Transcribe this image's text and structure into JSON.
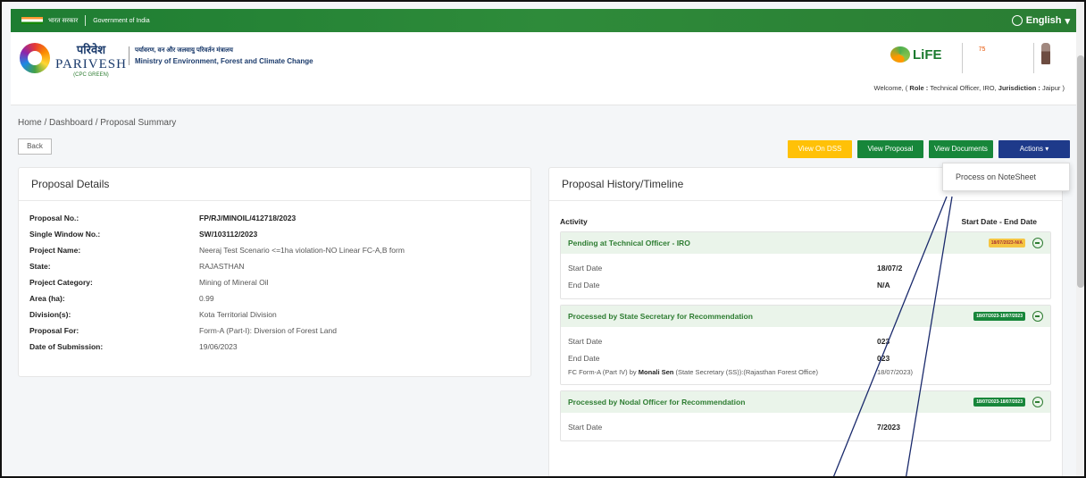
{
  "gov_bar": {
    "hindi_label": "भारत सरकार",
    "label": "Government of India",
    "language": "English"
  },
  "brand": {
    "hindi": "परिवेश",
    "name": "PARIVESH",
    "sub": "(CPC GREEN)"
  },
  "ministry": {
    "hindi": "पर्यावरण, वन और जलवायु परिवर्तन मंत्रालय",
    "name": "Ministry of Environment, Forest and Climate Change"
  },
  "life_logo": "LiFE",
  "welcome": {
    "prefix": "Welcome, (",
    "role_label": "Role :",
    "role": "Technical Officer, IRO,",
    "jurisdiction_label": "Jurisdiction :",
    "jurisdiction": "Jaipur",
    "suffix": ")"
  },
  "breadcrumb": "Home  /  Dashboard  /  Proposal Summary",
  "back_label": "Back",
  "toolbar": {
    "dss": "View On DSS",
    "proposal": "View Proposal",
    "documents": "View Documents",
    "actions": "Actions ▾"
  },
  "actions_menu": {
    "item": "Process on NoteSheet"
  },
  "details": {
    "title": "Proposal Details",
    "rows": [
      {
        "k": "Proposal No.:",
        "v": "FP/RJ/MINOIL/412718/2023"
      },
      {
        "k": "Single Window No.:",
        "v": "SW/103112/2023"
      },
      {
        "k": "Project Name:",
        "v": "Neeraj Test Scenario <=1ha violation-NO Linear FC-A,B form"
      },
      {
        "k": "State:",
        "v": "RAJASTHAN"
      },
      {
        "k": "Project Category:",
        "v": "Mining of Mineral Oil"
      },
      {
        "k": "Area (ha):",
        "v": "0.99"
      },
      {
        "k": "Division(s):",
        "v": "Kota Territorial Division"
      },
      {
        "k": "Proposal For:",
        "v": "Form-A (Part-I): Diversion of Forest Land"
      },
      {
        "k": "Date of Submission:",
        "v": "19/06/2023"
      }
    ]
  },
  "timeline": {
    "title": "Proposal History/Timeline",
    "activity_label": "Activity",
    "dates_label": "Start Date - End Date",
    "blocks": [
      {
        "title": "Pending at Technical Officer - IRO",
        "badge": "18/07/2023-N/A",
        "start_label": "Start Date",
        "start": "18/07/2",
        "end_label": "End Date",
        "end": "N/A"
      },
      {
        "title": "Processed by State Secretary for Recommendation",
        "badge": "18/07/2023-18/07/2023",
        "start_label": "Start Date",
        "start": "023",
        "end_label": "End Date",
        "end": "023",
        "note_pre": "FC Form-A (Part IV) by",
        "note_name": "Monali Sen",
        "note_post": "(State Secretary (SS)):(Rajasthan Forest Office)",
        "note_date": "18/07/2023)"
      },
      {
        "title": "Processed by Nodal Officer for Recommendation",
        "badge": "18/07/2023-18/07/2023",
        "start_label": "Start Date",
        "start": "7/2023"
      }
    ]
  }
}
